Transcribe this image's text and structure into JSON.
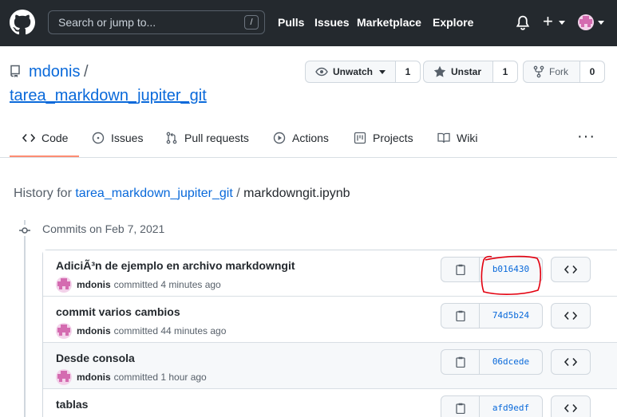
{
  "header": {
    "search_placeholder": "Search or jump to...",
    "search_shortcut": "/",
    "nav": [
      "Pulls",
      "Issues",
      "Marketplace",
      "Explore"
    ],
    "plus_symbol": "+"
  },
  "repo": {
    "owner": "mdonis",
    "separator": "/",
    "name": "tarea_markdown_jupiter_git",
    "watch_label": "Unwatch",
    "watch_count": "1",
    "star_label": "Unstar",
    "star_count": "1",
    "fork_label": "Fork",
    "fork_count": "0"
  },
  "tabs": [
    {
      "label": "Code",
      "icon": "code-icon"
    },
    {
      "label": "Issues",
      "icon": "issue-icon"
    },
    {
      "label": "Pull requests",
      "icon": "pull-request-icon"
    },
    {
      "label": "Actions",
      "icon": "play-icon"
    },
    {
      "label": "Projects",
      "icon": "project-icon"
    },
    {
      "label": "Wiki",
      "icon": "book-icon"
    }
  ],
  "more_label": "···",
  "history": {
    "prefix": "History for",
    "repo_link": "tarea_markdown_jupiter_git",
    "separator": "/",
    "file": "markdowngit.ipynb"
  },
  "commits_on": "Commits on Feb 7, 2021",
  "commits": [
    {
      "title": "AdiciÃ³n de ejemplo en archivo markdowngit",
      "author": "mdonis",
      "time": "committed 4 minutes ago",
      "sha": "b016430"
    },
    {
      "title": "commit varios cambios",
      "author": "mdonis",
      "time": "committed 44 minutes ago",
      "sha": "74d5b24"
    },
    {
      "title": "Desde consola",
      "author": "mdonis",
      "time": "committed 1 hour ago",
      "sha": "06dcede"
    },
    {
      "title": "tablas",
      "author": "",
      "time": "",
      "sha": "afd9edf"
    }
  ],
  "colors": {
    "header_bg": "#24292e",
    "link": "#0969da",
    "tab_active": "#fd8c73",
    "annotation": "#e3000f"
  }
}
